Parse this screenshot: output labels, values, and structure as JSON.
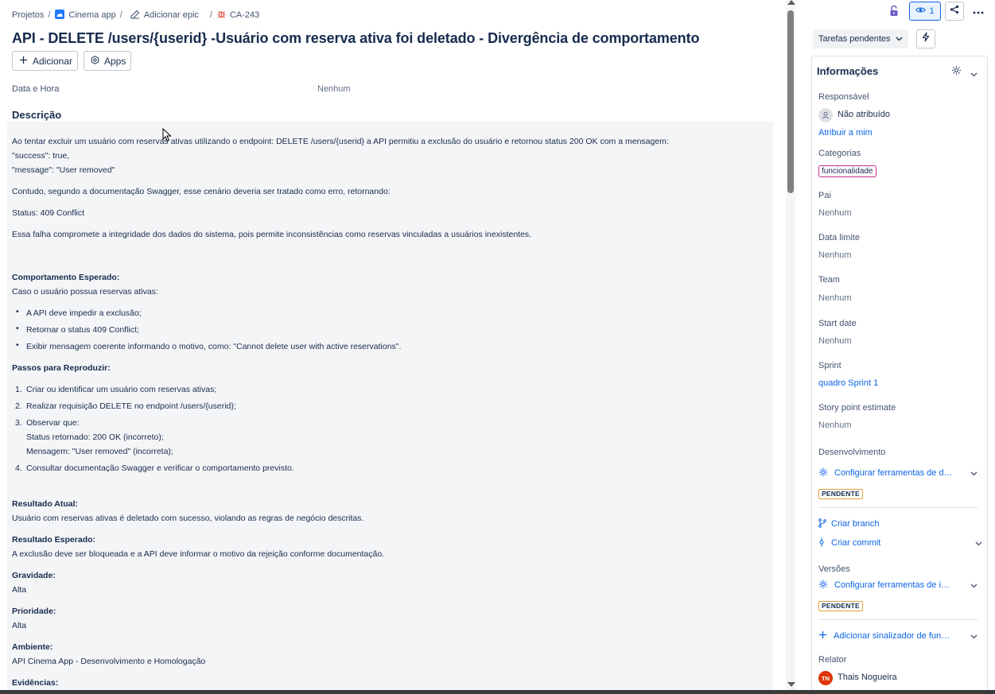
{
  "breadcrumbs": {
    "projects": "Projetos",
    "project": "Cinema app",
    "epic": "Adicionar epic",
    "issue_key": "CA-243",
    "separator": "/"
  },
  "issue": {
    "title": "API - DELETE /users/{userid} -Usuário com reserva ativa foi deletado - Divergência de comportamento",
    "add_button": "Adicionar",
    "apps_button": "Apps",
    "date_field_label": "Data e Hora",
    "date_field_value": "Nenhum",
    "description_heading": "Descrição"
  },
  "description": {
    "p1": "Ao tentar excluir um usuário com reservas ativas utilizando o endpoint: DELETE /users/{userid} a API permitiu a exclusão do usuário e retornou status 200 OK com a mensagem:",
    "p1b": "\"success\": true,",
    "p1c": "\"message\": \"User removed\"",
    "p2": " Contudo, segundo a documentação Swagger, esse cenário deveria ser tratado como erro, retornando:",
    "p3": "Status: 409 Conflict",
    "p4": "Essa falha compromete a integridade dos dados do sistema, pois permite inconsistências como reservas vinculadas a usuários inexistentes.",
    "expected_heading": "Comportamento Esperado:",
    "expected_intro": "Caso o usuário possua reservas ativas:",
    "expected_items": [
      "A API deve impedir a exclusão;",
      "Retornar o status 409 Conflict;",
      "Exibir mensagem coerente informando o motivo, como: \"Cannot delete user with active reservations\"."
    ],
    "steps_heading": "Passos para Reproduzir:",
    "steps": [
      "Criar ou identificar um usuário com reservas ativas;",
      "Realizar requisição DELETE no endpoint /users/{userid};",
      "Observar que:",
      "Consultar documentação Swagger e verificar o comportamento previsto."
    ],
    "step3_sub1": "Status retornado: 200 OK (incorreto);",
    "step3_sub2": " Mensagem: \"User removed\" (incorreta);",
    "actual_heading": "Resultado Atual:",
    "actual_text": "Usuário com reservas ativas é deletado com sucesso, violando as regras de negócio descritas.",
    "expected_result_heading": "Resultado Esperado:",
    "expected_result_text": "A exclusão deve ser bloqueada e a API deve informar o motivo da rejeição conforme documentação.",
    "severity_heading": "Gravidade:",
    "severity_value": "Alta",
    "priority_heading": "Prioridade:",
    "priority_value": "Alta",
    "env_heading": "Ambiente:",
    "env_value": "API Cinema App - Desenvolvimento e Homologação",
    "evidence_heading": "Evidências:"
  },
  "toolbar": {
    "watch_count": "1",
    "status": "Tarefas pendentes"
  },
  "info": {
    "header": "Informações",
    "assignee_label": "Responsável",
    "assignee_value": "Não atribuído",
    "assign_me": "Atribuir a mim",
    "categories_label": "Categorias",
    "category_tag": "funcionalidade",
    "parent_label": "Pai",
    "parent_value": "Nenhum",
    "due_label": "Data limite",
    "due_value": "Nenhum",
    "team_label": "Team",
    "team_value": "Nenhum",
    "start_label": "Start date",
    "start_value": "Nenhum",
    "sprint_label": "Sprint",
    "sprint_value": "quadro Sprint 1",
    "story_label": "Story point estimate",
    "story_value": "Nenhum",
    "dev_label": "Desenvolvimento",
    "dev_config": "Configurar ferramentas de desenvolvimento",
    "pending_badge": "PENDENTE",
    "create_branch": "Criar branch",
    "create_commit": "Criar commit",
    "versions_label": "Versões",
    "versions_config": "Configurar ferramentas de implantação",
    "pending_badge2": "PENDENTE",
    "add_flag": "Adicionar sinalizador de funcionalidade",
    "reporter_label": "Relator",
    "reporter_initials": "TN",
    "reporter_name": "Thais Nogueira"
  },
  "colors": {
    "link": "#0c66e4",
    "text": "#172b4d",
    "tag_border": "#c62a88",
    "badge_border": "#e2a03f",
    "reporter_avatar": "#de350b",
    "description_bg": "#f4f5f7"
  }
}
